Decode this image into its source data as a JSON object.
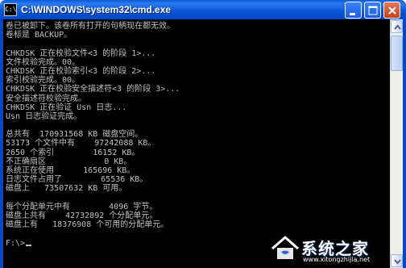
{
  "window": {
    "title": "C:\\WINDOWS\\system32\\cmd.exe",
    "icon_glyph": "C:\\"
  },
  "console": {
    "lines": [
      "卷已被卸下。该卷所有打开的句柄现在都无效。",
      "卷标是 BACKUP。",
      "",
      "CHKDSK 正在校验文件<3 的阶段 1>...",
      "文件校验完成。00。",
      "CHKDSK 正在校验索引<3 的阶段 2>...",
      "索引校验完成。00。",
      "CHKDSK 正在校验安全描述符<3 的阶段 3>...",
      "安全描述符校验完成。",
      "CHKDSK 正在验证 Usn 日志...",
      "Usn 日志验证完成。",
      "",
      "总共有  170931568 KB 磁盘空间。",
      "53173 个文件中有    97242088 KB。",
      "2650 个索引        16152 KB。",
      "不正确扇区            0 KB。",
      "系统正在使用      165696 KB。",
      "日志文件占用了        65536 KB。",
      "磁盘上   73507632 KB 可用。",
      "",
      "每个分配单元中有        4096 字节。",
      "磁盘上共有    42732892 个分配单元。",
      "磁盘上有   18376908 个可用的分配单元。",
      "",
      "F:\\>"
    ]
  },
  "watermark": {
    "brand": "系统之家",
    "url": "www.xitongzhijia.net"
  },
  "icons": {
    "app": "cmd-icon",
    "minimize": "minimize-icon",
    "maximize": "maximize-icon",
    "close": "close-icon",
    "scroll_up": "arrow-up-icon",
    "scroll_down": "arrow-down-icon",
    "logo": "house-logo-icon"
  }
}
